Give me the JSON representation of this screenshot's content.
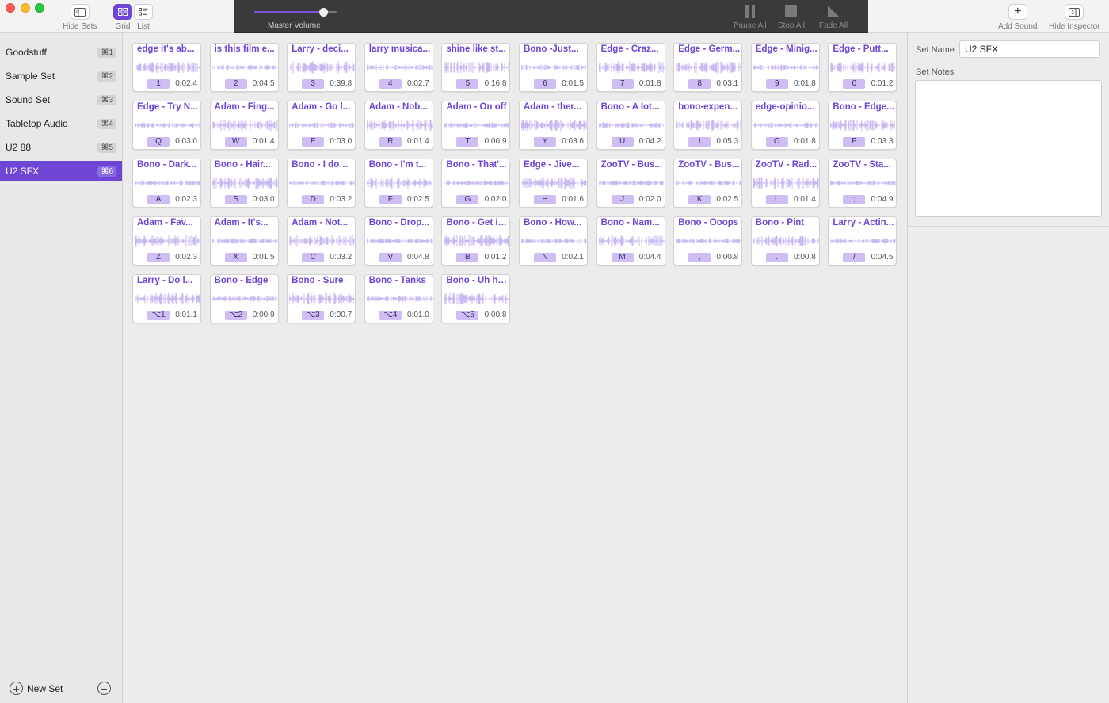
{
  "toolbar": {
    "hide_sets_label": "Hide Sets",
    "grid_label": "Grid",
    "list_label": "List",
    "master_volume_label": "Master Volume",
    "master_volume_value": 0.84,
    "pause_all_label": "Pause All",
    "stop_all_label": "Stop All",
    "fade_all_label": "Fade All",
    "add_sound_label": "Add Sound",
    "hide_inspector_label": "Hide Inspector",
    "accent_color": "#6f45d6"
  },
  "sidebar": {
    "sets": [
      {
        "name": "Goodstuff",
        "shortcut": "⌘1",
        "active": false
      },
      {
        "name": "Sample Set",
        "shortcut": "⌘2",
        "active": false
      },
      {
        "name": "Sound Set",
        "shortcut": "⌘3",
        "active": false
      },
      {
        "name": "Tabletop Audio",
        "shortcut": "⌘4",
        "active": false
      },
      {
        "name": "U2 88",
        "shortcut": "⌘5",
        "active": false
      },
      {
        "name": "U2 SFX",
        "shortcut": "⌘6",
        "active": true
      }
    ],
    "new_set_label": "New Set"
  },
  "sounds": [
    {
      "title": "edge it's ab...",
      "key": "1",
      "duration": "0:02.4"
    },
    {
      "title": "is this film e...",
      "key": "2",
      "duration": "0:04.5"
    },
    {
      "title": "Larry - deci...",
      "key": "3",
      "duration": "0:39.8"
    },
    {
      "title": "larry musica...",
      "key": "4",
      "duration": "0:02.7"
    },
    {
      "title": "shine like st...",
      "key": "5",
      "duration": "0:16.8"
    },
    {
      "title": "Bono -Just...",
      "key": "6",
      "duration": "0:01.5"
    },
    {
      "title": "Edge - Craz...",
      "key": "7",
      "duration": "0:01.8"
    },
    {
      "title": "Edge - Germ...",
      "key": "8",
      "duration": "0:03.1"
    },
    {
      "title": "Edge - Minig...",
      "key": "9",
      "duration": "0:01.8"
    },
    {
      "title": "Edge - Putt...",
      "key": "0",
      "duration": "0:01.2"
    },
    {
      "title": "Edge - Try N...",
      "key": "Q",
      "duration": "0:03.0"
    },
    {
      "title": "Adam - Fing...",
      "key": "W",
      "duration": "0:01.4"
    },
    {
      "title": "Adam - Go l...",
      "key": "E",
      "duration": "0:03.0"
    },
    {
      "title": "Adam - Nob...",
      "key": "R",
      "duration": "0:01.4"
    },
    {
      "title": "Adam - On off",
      "key": "T",
      "duration": "0:00.9"
    },
    {
      "title": "Adam - ther...",
      "key": "Y",
      "duration": "0:03.6"
    },
    {
      "title": "Bono - A lot...",
      "key": "U",
      "duration": "0:04.2"
    },
    {
      "title": "bono-expen...",
      "key": "I",
      "duration": "0:05.3"
    },
    {
      "title": "edge-opinio...",
      "key": "O",
      "duration": "0:01.8"
    },
    {
      "title": "Bono - Edge...",
      "key": "P",
      "duration": "0:03.3"
    },
    {
      "title": "Bono - Dark...",
      "key": "A",
      "duration": "0:02.3"
    },
    {
      "title": "Bono - Hair...",
      "key": "S",
      "duration": "0:03.0"
    },
    {
      "title": "Bono - I don'...",
      "key": "D",
      "duration": "0:03.2"
    },
    {
      "title": "Bono - I'm t...",
      "key": "F",
      "duration": "0:02.5"
    },
    {
      "title": "Bono - That'...",
      "key": "G",
      "duration": "0:02.0"
    },
    {
      "title": "Edge - Jive...",
      "key": "H",
      "duration": "0:01.6"
    },
    {
      "title": "ZooTV - Bus...",
      "key": "J",
      "duration": "0:02.0"
    },
    {
      "title": "ZooTV - Bus...",
      "key": "K",
      "duration": "0:02.5"
    },
    {
      "title": "ZooTV - Rad...",
      "key": "L",
      "duration": "0:01.4"
    },
    {
      "title": "ZooTV - Sta...",
      "key": ";",
      "duration": "0:04.9"
    },
    {
      "title": "Adam - Fav...",
      "key": "Z",
      "duration": "0:02.3"
    },
    {
      "title": "Adam - It's...",
      "key": "X",
      "duration": "0:01.5"
    },
    {
      "title": "Adam - Not...",
      "key": "C",
      "duration": "0:03.2"
    },
    {
      "title": "Bono - Drop...",
      "key": "V",
      "duration": "0:04.8"
    },
    {
      "title": "Bono - Get it...",
      "key": "B",
      "duration": "0:01.2"
    },
    {
      "title": "Bono - How...",
      "key": "N",
      "duration": "0:02.1"
    },
    {
      "title": "Bono - Nam...",
      "key": "M",
      "duration": "0:04.4"
    },
    {
      "title": "Bono - Ooops",
      "key": ",",
      "duration": "0:00.8"
    },
    {
      "title": "Bono - Pint",
      "key": ".",
      "duration": "0:00.8"
    },
    {
      "title": "Larry - Actin...",
      "key": "/",
      "duration": "0:04.5"
    },
    {
      "title": "Larry - Do l...",
      "key": "⌥1",
      "duration": "0:01.1"
    },
    {
      "title": "Bono - Edge",
      "key": "⌥2",
      "duration": "0:00.9"
    },
    {
      "title": "Bono - Sure",
      "key": "⌥3",
      "duration": "0:00.7"
    },
    {
      "title": "Bono - Tanks",
      "key": "⌥4",
      "duration": "0:01.0"
    },
    {
      "title": "Bono - Uh huh",
      "key": "⌥5",
      "duration": "0:00.8"
    }
  ],
  "inspector": {
    "set_name_label": "Set Name",
    "set_name_value": "U2 SFX",
    "set_notes_label": "Set Notes",
    "set_notes_value": ""
  }
}
